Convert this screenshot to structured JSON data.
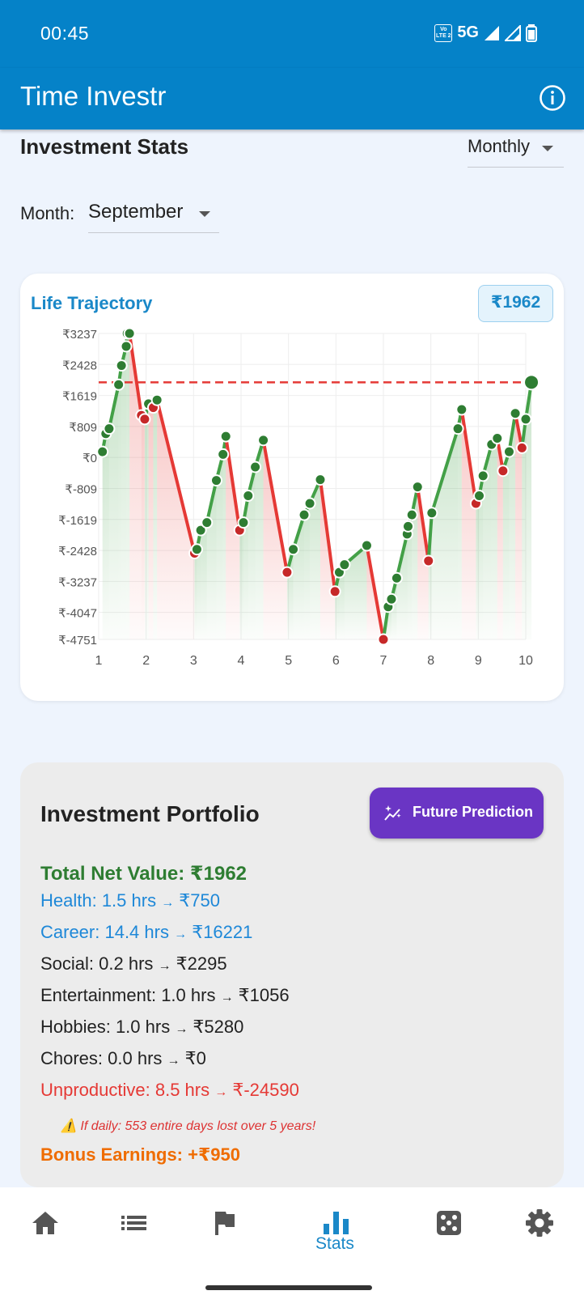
{
  "status_bar": {
    "time": "00:45",
    "volte": "Vo LTE 2",
    "network": "5G"
  },
  "app_bar": {
    "title": "Time Investr",
    "info_icon": "info-icon"
  },
  "header": {
    "title": "Investment Stats",
    "period_select": {
      "value": "Monthly",
      "icon": "dropdown-caret-icon"
    },
    "month_label": "Month:",
    "month_select": {
      "value": "September",
      "icon": "dropdown-caret-icon"
    }
  },
  "chart_card": {
    "title": "Life Trajectory",
    "badge": "₹1962"
  },
  "chart_data": {
    "type": "line",
    "title": "Life Trajectory",
    "xlabel": "",
    "ylabel": "",
    "xlim": [
      1,
      10
    ],
    "ylim": [
      -4751,
      3237
    ],
    "x_ticks": [
      1,
      2,
      3,
      4,
      5,
      6,
      7,
      8,
      9,
      10
    ],
    "y_ticks": [
      3237,
      2428,
      1619,
      809,
      0,
      -809,
      -1619,
      -2428,
      -3237,
      -4047,
      -4751
    ],
    "y_tick_labels": [
      "₹3237",
      "₹2428",
      "₹1619",
      "₹809",
      "₹0",
      "₹-809",
      "₹-1619",
      "₹-2428",
      "₹-3237",
      "₹-4047",
      "₹-4751"
    ],
    "reference_line": {
      "value": 1962,
      "style": "dashed",
      "color": "#e53935"
    },
    "up_color": "#43a047",
    "down_color": "#e53935",
    "grid": true,
    "series": [
      {
        "x": [
          1.08,
          1.15,
          1.22,
          1.42,
          1.48,
          1.58,
          1.6,
          1.65,
          1.9,
          1.97,
          2.05,
          2.15,
          2.23,
          3.02,
          3.07,
          3.15,
          3.28,
          3.48,
          3.62,
          3.68,
          3.97,
          4.05,
          4.15,
          4.3,
          4.47,
          4.97,
          5.1,
          5.33,
          5.45,
          5.67,
          5.98,
          6.07,
          6.18,
          6.65,
          7.0,
          7.1,
          7.17,
          7.28,
          7.5,
          7.52,
          7.6,
          7.72,
          7.95,
          8.02,
          8.57,
          8.65,
          8.95,
          9.02,
          9.1,
          9.28,
          9.4,
          9.52,
          9.65,
          9.78,
          9.92,
          10.0,
          10.12
        ],
        "y": [
          150,
          620,
          750,
          1900,
          2400,
          2900,
          3237,
          3237,
          1100,
          1000,
          1400,
          1300,
          1500,
          -2500,
          -2400,
          -1900,
          -1700,
          -600,
          80,
          550,
          -1900,
          -1700,
          -1000,
          -250,
          450,
          -3000,
          -2400,
          -1500,
          -1200,
          -580,
          -3500,
          -3000,
          -2800,
          -2300,
          -4751,
          -3900,
          -3700,
          -3150,
          -2000,
          -1800,
          -1500,
          -770,
          -2700,
          -1450,
          750,
          1250,
          -1200,
          -1000,
          -480,
          340,
          500,
          -350,
          150,
          1150,
          250,
          1000,
          1962
        ]
      }
    ]
  },
  "portfolio": {
    "title": "Investment Portfolio",
    "button": {
      "label": "Future Prediction",
      "icon": "sparkle-chart-icon"
    },
    "total": "Total Net Value: ₹1962",
    "rows": [
      {
        "category": "Health",
        "hours": "1.5 hrs",
        "arrow": "→",
        "value": "₹750",
        "color": "#1e88d8"
      },
      {
        "category": "Career",
        "hours": "14.4 hrs",
        "arrow": "→",
        "value": "₹16221",
        "color": "#1e88d8"
      },
      {
        "category": "Social",
        "hours": "0.2 hrs",
        "arrow": "→",
        "value": "₹2295",
        "color": "#222222"
      },
      {
        "category": "Entertainment",
        "hours": "1.0 hrs",
        "arrow": "→",
        "value": "₹1056",
        "color": "#222222"
      },
      {
        "category": "Hobbies",
        "hours": "1.0 hrs",
        "arrow": "→",
        "value": "₹5280",
        "color": "#222222"
      },
      {
        "category": "Chores",
        "hours": "0.0 hrs",
        "arrow": "→",
        "value": "₹0",
        "color": "#222222"
      },
      {
        "category": "Unproductive",
        "hours": "8.5 hrs",
        "arrow": "→",
        "value": "₹-24590",
        "color": "#e53935"
      }
    ],
    "warning": "⚠️ If daily: 553 entire days lost over 5 years!",
    "bonus": "Bonus Earnings: +₹950"
  },
  "bottom_nav": {
    "items": [
      {
        "icon": "home-icon",
        "label": ""
      },
      {
        "icon": "list-icon",
        "label": ""
      },
      {
        "icon": "flag-icon",
        "label": ""
      },
      {
        "icon": "bar-chart-icon",
        "label": "Stats",
        "active": true
      },
      {
        "icon": "dice-icon",
        "label": ""
      },
      {
        "icon": "gear-icon",
        "label": ""
      }
    ]
  }
}
